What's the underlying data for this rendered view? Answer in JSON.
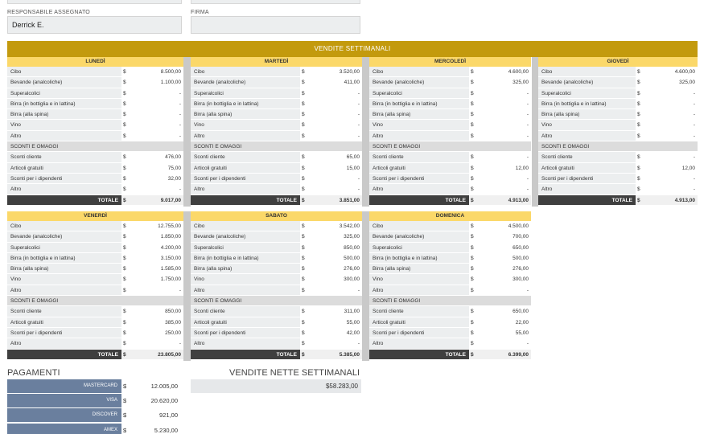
{
  "header": {
    "responsabile_label": "RESPONSABILE ASSEGNATO",
    "responsabile_value": "Derrick E.",
    "firma_label": "FIRMA",
    "firma_value": ""
  },
  "banner": "VENDITE SETTIMANALI",
  "rows_top": [
    "Cibo",
    "Bevande (analcoliche)",
    "Superalcolici",
    "Birra (in bottiglia e in lattina)",
    "Birra (alla spina)",
    "Vino",
    "Altro"
  ],
  "section_label": "SCONTI E OMAGGI",
  "rows_bottom": [
    "Sconti cliente",
    "Articoli gratuiti",
    "Sconti per i dipendenti",
    "Altro"
  ],
  "total_label": "TOTALE",
  "currency": "$",
  "days": [
    {
      "name": "LUNEDÌ",
      "top": [
        "8.500,00",
        "1.100,00",
        "-",
        "-",
        "-",
        "-",
        "-"
      ],
      "bottom": [
        "476,00",
        "75,00",
        "32,00",
        "-"
      ],
      "total": "9.017,00"
    },
    {
      "name": "MARTEDÌ",
      "top": [
        "3.520,00",
        "411,00",
        "-",
        "-",
        "-",
        "-",
        "-"
      ],
      "bottom": [
        "65,00",
        "15,00",
        "-",
        "-"
      ],
      "total": "3.851,00"
    },
    {
      "name": "MERCOLEDÌ",
      "top": [
        "4.600,00",
        "325,00",
        "-",
        "-",
        "-",
        "-",
        "-"
      ],
      "bottom": [
        "-",
        "12,00",
        "-",
        "-"
      ],
      "total": "4.913,00"
    },
    {
      "name": "GIOVEDÌ",
      "top": [
        "4.600,00",
        "325,00",
        "-",
        "-",
        "-",
        "-",
        "-"
      ],
      "bottom": [
        "-",
        "12,00",
        "-",
        "-"
      ],
      "total": "4.913,00"
    },
    {
      "name": "VENERDÌ",
      "top": [
        "12.755,00",
        "1.850,00",
        "4.200,00",
        "3.150,00",
        "1.585,00",
        "1.750,00",
        "-"
      ],
      "bottom": [
        "850,00",
        "385,00",
        "250,00",
        "-"
      ],
      "total": "23.805,00"
    },
    {
      "name": "SABATO",
      "top": [
        "3.542,00",
        "325,00",
        "850,00",
        "500,00",
        "276,00",
        "300,00",
        "-"
      ],
      "bottom": [
        "311,00",
        "55,00",
        "42,00",
        "-"
      ],
      "total": "5.385,00"
    },
    {
      "name": "DOMENICA",
      "top": [
        "4.500,00",
        "700,00",
        "650,00",
        "500,00",
        "276,00",
        "300,00",
        "-"
      ],
      "bottom": [
        "650,00",
        "22,00",
        "55,00",
        "-"
      ],
      "total": "6.399,00"
    }
  ],
  "payments": {
    "title": "PAGAMENTI",
    "items": [
      {
        "label": "MASTERCARD",
        "value": "12.005,00"
      },
      {
        "label": "VISA",
        "value": "20.620,00"
      },
      {
        "label": "DISCOVER",
        "value": "921,00"
      },
      {
        "label": "AMEX",
        "value": "5.230,00"
      }
    ]
  },
  "net": {
    "title": "VENDITE NETTE SETTIMANALI",
    "value": "$58.283,00"
  },
  "colors": {
    "banner": "#c39a0d",
    "day_header": "#fbd869",
    "total_bar": "#3f3f3f",
    "payment_label": "#6a7f9e"
  }
}
